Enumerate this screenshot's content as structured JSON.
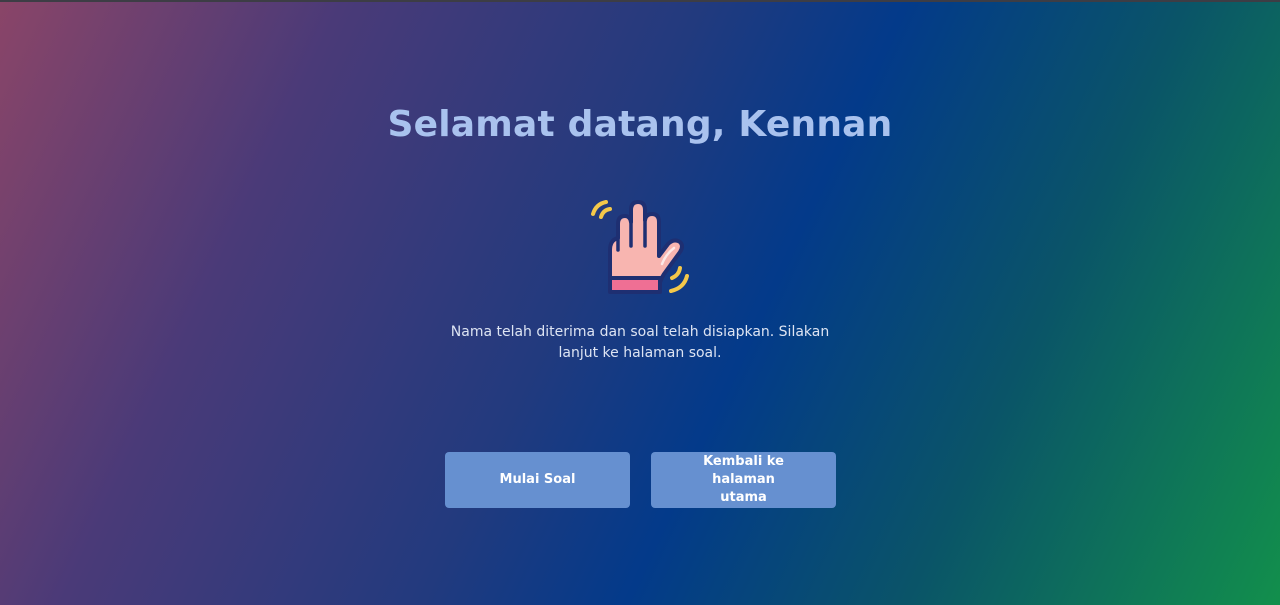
{
  "welcome": {
    "title": "Selamat datang, Kennan",
    "icon": "waving-hand-icon",
    "message": "Nama telah diterima dan soal telah disiapkan. Silakan lanjut ke halaman soal."
  },
  "actions": {
    "start_label": "Mulai Soal",
    "back_label": "Kembali ke halaman utama"
  },
  "colors": {
    "title": "#a9c2ee",
    "button": "#6690d0",
    "gradient_start": "#8a4568",
    "gradient_mid": "#033a8a",
    "gradient_end": "#128f4c"
  }
}
